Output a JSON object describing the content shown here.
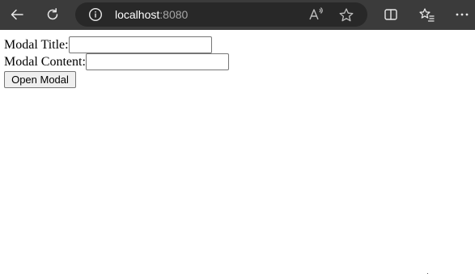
{
  "browser": {
    "address_host": "localhost",
    "address_port": ":8080"
  },
  "form": {
    "title_label": "Modal Title:",
    "title_value": "",
    "content_label": "Modal Content:",
    "content_value": "",
    "open_button_label": "Open Modal"
  }
}
